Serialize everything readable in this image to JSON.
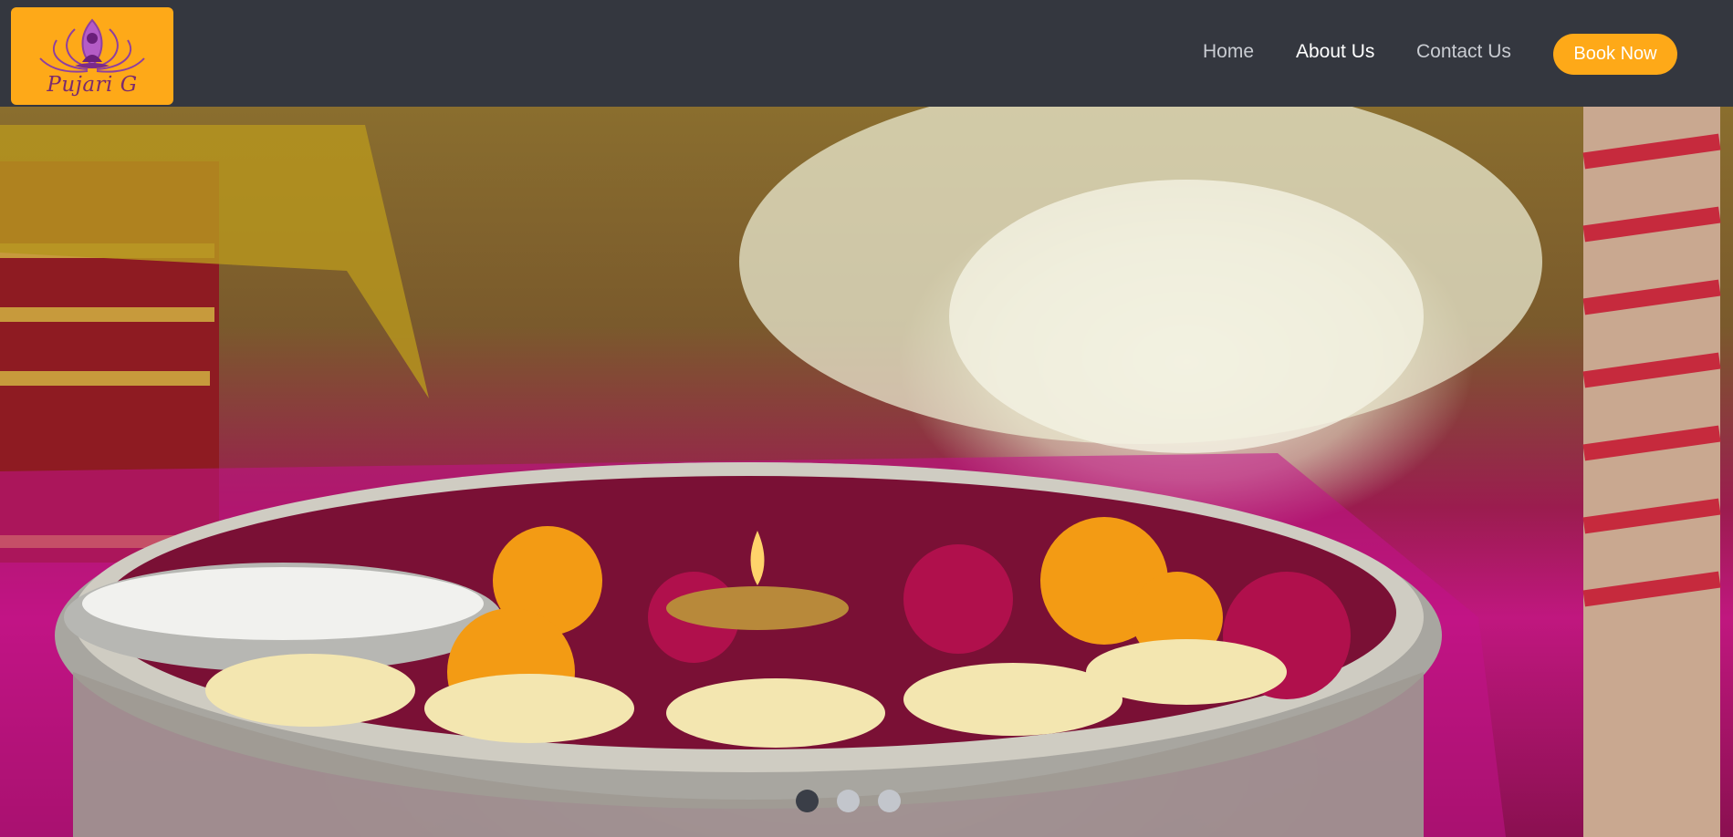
{
  "brand": {
    "name": "Pujari G",
    "logo_bg": "#fea918"
  },
  "nav": {
    "items": [
      {
        "label": "Home",
        "active": false
      },
      {
        "label": "About Us",
        "active": true
      },
      {
        "label": "Contact Us",
        "active": false
      }
    ],
    "cta_label": "Book Now"
  },
  "hero": {
    "slides_total": 3,
    "active_slide": 1,
    "image_icon": "puja-thali-image"
  },
  "colors": {
    "navbar": "#34373f",
    "accent": "#fea918",
    "nav_text": "#c9ccd2",
    "nav_text_active": "#ffffff"
  }
}
